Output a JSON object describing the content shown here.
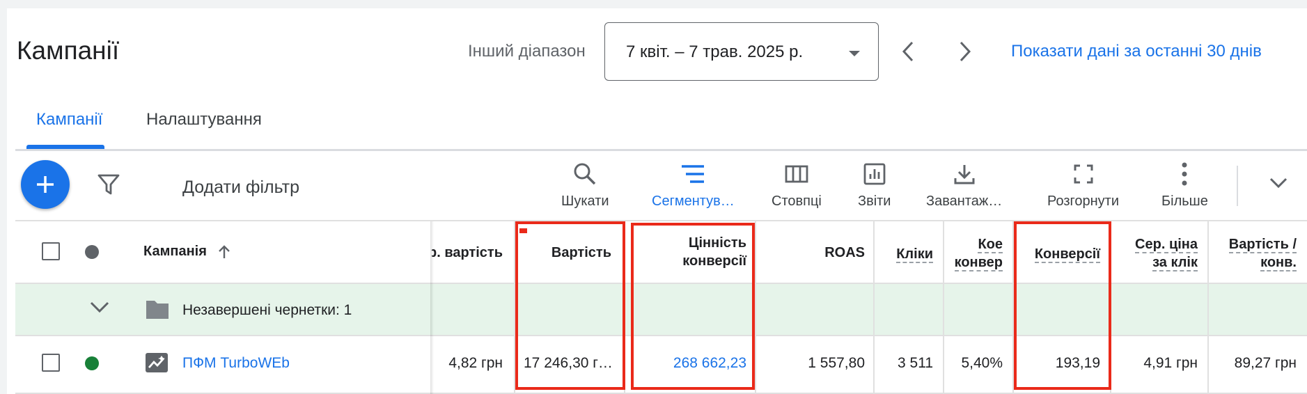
{
  "header": {
    "title": "Кампанії",
    "range_label": "Інший діапазон",
    "date_range": "7 квіт. – 7 трав. 2025 р.",
    "show_last_30": "Показати дані за останні 30 днів"
  },
  "tabs": [
    {
      "label": "Кампанії",
      "active": true
    },
    {
      "label": "Налаштування",
      "active": false
    }
  ],
  "toolbar": {
    "add_filter": "Додати фільтр",
    "tools": [
      {
        "icon": "search-icon",
        "label": "Шукати"
      },
      {
        "icon": "segment-icon",
        "label": "Сегментув…"
      },
      {
        "icon": "columns-icon",
        "label": "Стовпці"
      },
      {
        "icon": "reports-icon",
        "label": "Звіти"
      },
      {
        "icon": "download-icon",
        "label": "Завантаж…"
      },
      {
        "icon": "expand-icon",
        "label": "Розгорнути"
      },
      {
        "icon": "more-vert-icon",
        "label": "Більше"
      }
    ]
  },
  "table": {
    "headers": {
      "campaign": "Кампанія",
      "avg_cost": "р. вартість",
      "cost": "Вартість",
      "conv_value_1": "Цінність",
      "conv_value_2": "конверсії",
      "roas": "ROAS",
      "clicks": "Кліки",
      "conv_rate_1": "Кое",
      "conv_rate_2": "конвер",
      "conversions": "Конверсії",
      "cpc_1": "Сер. ціна",
      "cpc_2": "за клік",
      "cost_conv_1": "Вартість /",
      "cost_conv_2": "конв."
    },
    "group_row": {
      "label": "Незавершені чернетки: 1"
    },
    "rows": [
      {
        "campaign": "ПФМ TurboWEb",
        "avg_cost": "4,82 грн",
        "cost": "17 246,30 г…",
        "conv_value": "268 662,23",
        "roas": "1 557,80",
        "clicks": "3 511",
        "conv_rate": "5,40%",
        "conversions": "193,19",
        "cpc": "4,91 грн",
        "cost_conv": "89,27 грн",
        "status_color": "#188038"
      }
    ]
  },
  "colors": {
    "accent": "#1a73e8",
    "highlight_box": "#ea2a1a",
    "group_row_bg": "#e6f4ea",
    "status_enabled": "#188038"
  }
}
